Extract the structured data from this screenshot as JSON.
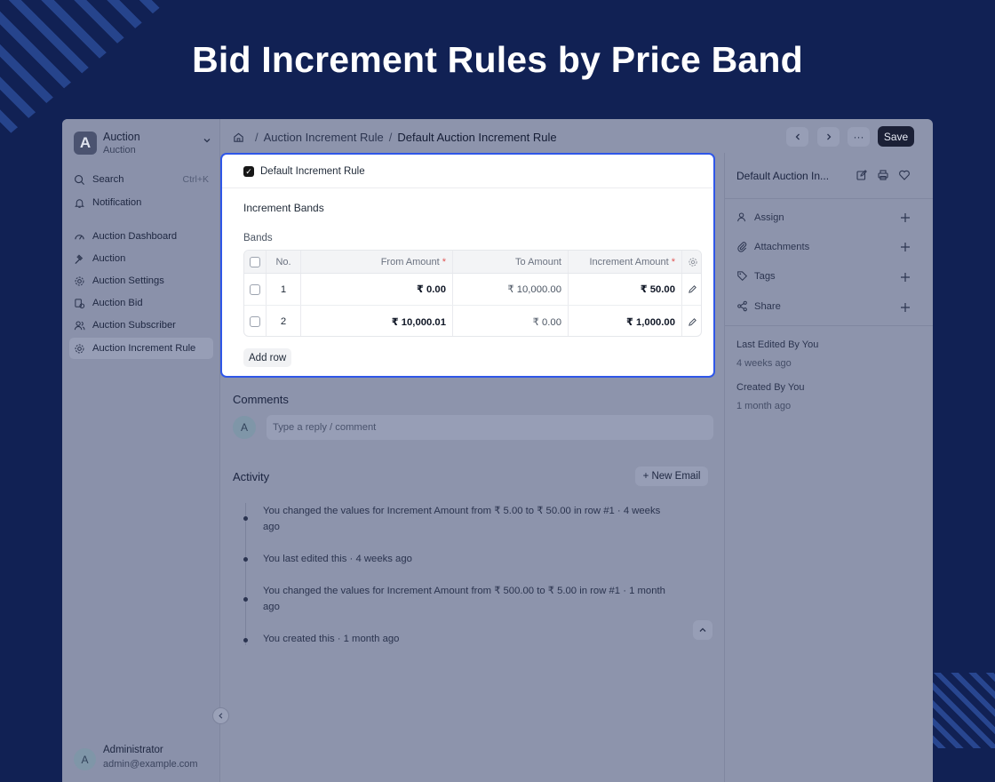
{
  "headline": "Bid Increment Rules by Price Band",
  "colors": {
    "background": "#112154",
    "accent": "#2f57e8",
    "save_button": "#1b2036"
  },
  "sidebar": {
    "workspace_initial": "A",
    "workspace_name": "Auction",
    "workspace_sub": "Auction",
    "search_label": "Search",
    "search_hint": "Ctrl+K",
    "notification_label": "Notification",
    "items": [
      {
        "label": "Auction Dashboard",
        "icon": "dashboard-icon"
      },
      {
        "label": "Auction",
        "icon": "gavel-icon"
      },
      {
        "label": "Auction Settings",
        "icon": "gear-icon"
      },
      {
        "label": "Auction Bid",
        "icon": "bid-icon"
      },
      {
        "label": "Auction Subscriber",
        "icon": "users-icon"
      },
      {
        "label": "Auction Increment Rule",
        "icon": "gear-icon"
      }
    ],
    "user_initial": "A",
    "user_name": "Administrator",
    "user_email": "admin@example.com"
  },
  "topbar": {
    "breadcrumb": [
      "Auction Increment Rule",
      "Default Auction Increment Rule"
    ],
    "separator": "/",
    "more_label": "···",
    "save_label": "Save"
  },
  "form": {
    "default_rule_label": "Default Increment Rule",
    "default_rule_checked": true,
    "section_title": "Increment Bands",
    "bands_label": "Bands",
    "columns": {
      "no": "No.",
      "from": "From Amount",
      "to": "To Amount",
      "increment": "Increment Amount",
      "required_mark": "*"
    },
    "rows": [
      {
        "no": "1",
        "from": "₹ 0.00",
        "to": "₹ 10,000.00",
        "increment": "₹ 50.00"
      },
      {
        "no": "2",
        "from": "₹ 10,000.01",
        "to": "₹ 0.00",
        "increment": "₹ 1,000.00"
      }
    ],
    "add_row_label": "Add row"
  },
  "comments": {
    "title": "Comments",
    "avatar_initial": "A",
    "placeholder": "Type a reply / comment"
  },
  "activity": {
    "title": "Activity",
    "new_email_label": "+ New Email",
    "entries": [
      {
        "line1": "You changed the values for Increment Amount from ₹ 5.00 to ₹ 50.00 in row #1 · 4 weeks",
        "line2": "ago"
      },
      {
        "line1": "You last edited this · 4 weeks ago",
        "line2": ""
      },
      {
        "line1": "You changed the values for Increment Amount from ₹ 500.00 to ₹ 5.00 in row #1 · 1 month",
        "line2": "ago"
      },
      {
        "line1": "You created this · 1 month ago",
        "line2": ""
      }
    ]
  },
  "rightbar": {
    "title": "Default Auction In...",
    "assign_label": "Assign",
    "attachments_label": "Attachments",
    "tags_label": "Tags",
    "share_label": "Share",
    "last_edited_label": "Last Edited By You",
    "last_edited_time": "4 weeks ago",
    "created_label": "Created By You",
    "created_time": "1 month ago"
  }
}
